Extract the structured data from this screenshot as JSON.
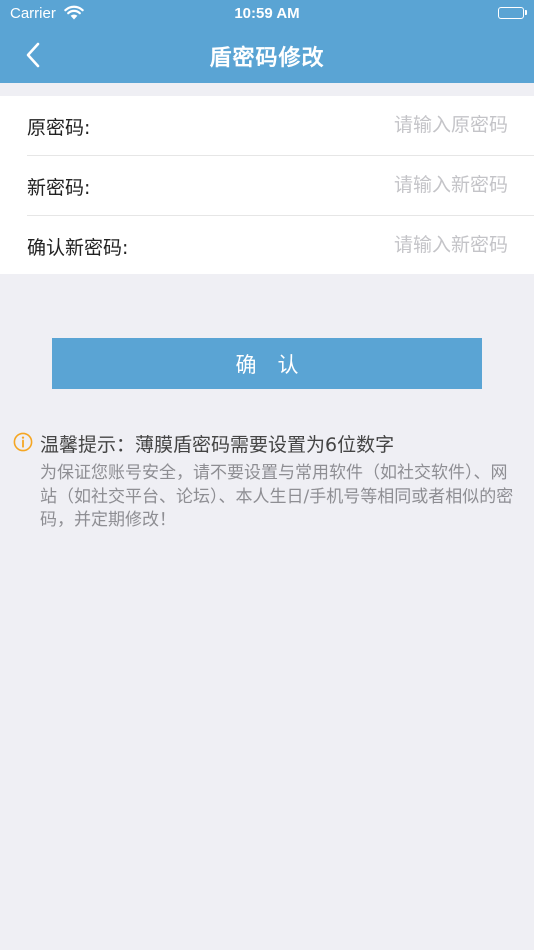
{
  "status_bar": {
    "carrier": "Carrier",
    "time": "10:59 AM",
    "battery_level": 1.0
  },
  "navbar": {
    "title": "盾密码修改",
    "back_icon": "chevron-left-icon"
  },
  "form": {
    "old_password": {
      "label": "原密码:",
      "placeholder": "请输入原密码",
      "value": ""
    },
    "new_password": {
      "label": "新密码:",
      "placeholder": "请输入新密码",
      "value": ""
    },
    "confirm_password": {
      "label": "确认新密码:",
      "placeholder": "请输入新密码",
      "value": ""
    }
  },
  "confirm_button": {
    "label": "确　认"
  },
  "tip": {
    "icon": "info-icon",
    "title": "温馨提示：薄膜盾密码需要设置为6位数字",
    "body": "为保证您账号安全，请不要设置与常用软件（如社交软件）、网站（如社交平台、论坛）、本人生日/手机号等相同或者相似的密码，并定期修改！"
  },
  "colors": {
    "primary": "#5aa4d4",
    "background": "#efeff4",
    "tip_icon": "#f5a623",
    "placeholder": "#c4c4c8"
  }
}
